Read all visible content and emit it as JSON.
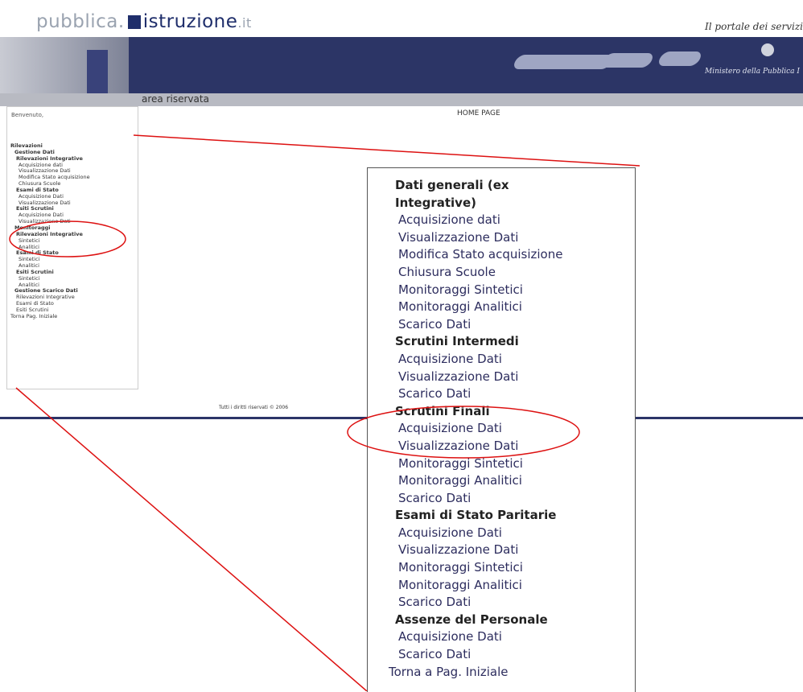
{
  "header": {
    "logo_text_1": "pubblica.",
    "logo_text_2": "istruzione",
    "logo_text_3": ".it",
    "portal_tagline": "Il portale dei servizi",
    "ministry": "Ministero della Pubblica I",
    "area_label": "area riservata"
  },
  "left_panel": {
    "welcome": "Benvenuto,",
    "items": [
      {
        "label": "Rilevazioni",
        "bold": true,
        "indent": 0
      },
      {
        "label": "Gestione Dati",
        "bold": true,
        "indent": 1
      },
      {
        "label": "Rilevazioni Integrative",
        "bold": true,
        "indent": 2
      },
      {
        "label": "Acquisizione dati",
        "bold": false,
        "indent": 3
      },
      {
        "label": "Visualizzazione Dati",
        "bold": false,
        "indent": 3
      },
      {
        "label": "Modifica Stato acquisizione",
        "bold": false,
        "indent": 3
      },
      {
        "label": "Chiusura Scuole",
        "bold": false,
        "indent": 3
      },
      {
        "label": "Esami di Stato",
        "bold": true,
        "indent": 2
      },
      {
        "label": "Acquisizione Dati",
        "bold": false,
        "indent": 3
      },
      {
        "label": "Visualizzazione Dati",
        "bold": false,
        "indent": 3
      },
      {
        "label": "Esiti Scrutini",
        "bold": true,
        "indent": 2
      },
      {
        "label": "Acquisizione Dati",
        "bold": false,
        "indent": 3
      },
      {
        "label": "Visualizzazione Dati",
        "bold": false,
        "indent": 3
      },
      {
        "label": "Monitoraggi",
        "bold": true,
        "indent": 1
      },
      {
        "label": "Rilevazioni Integrative",
        "bold": true,
        "indent": 2
      },
      {
        "label": "Sintetici",
        "bold": false,
        "indent": 3
      },
      {
        "label": "Analitici",
        "bold": false,
        "indent": 3
      },
      {
        "label": "Esami di Stato",
        "bold": true,
        "indent": 2
      },
      {
        "label": "Sintetici",
        "bold": false,
        "indent": 3
      },
      {
        "label": "Analitici",
        "bold": false,
        "indent": 3
      },
      {
        "label": "Esiti Scrutini",
        "bold": true,
        "indent": 2
      },
      {
        "label": "Sintetici",
        "bold": false,
        "indent": 3
      },
      {
        "label": "Analitici",
        "bold": false,
        "indent": 3
      },
      {
        "label": "Gestione Scarico Dati",
        "bold": true,
        "indent": 1
      },
      {
        "label": "Rilevazioni Integrative",
        "bold": false,
        "indent": 2
      },
      {
        "label": "Esami di Stato",
        "bold": false,
        "indent": 2
      },
      {
        "label": "Esiti Scrutini",
        "bold": false,
        "indent": 2
      },
      {
        "label": "Torna Pag. Iniziale",
        "bold": false,
        "indent": 0
      }
    ]
  },
  "main": {
    "title": "HOME PAGE",
    "footer": "Tutti i diritti riservati © 2006"
  },
  "zoomed_menu": {
    "items": [
      {
        "label": "Dati generali (ex",
        "bold": true,
        "indent": 1
      },
      {
        "label": "Integrative)",
        "bold": true,
        "indent": 1
      },
      {
        "label": "Acquisizione dati",
        "bold": false,
        "indent": 2
      },
      {
        "label": "Visualizzazione Dati",
        "bold": false,
        "indent": 2
      },
      {
        "label": "Modifica Stato acquisizione",
        "bold": false,
        "indent": 2
      },
      {
        "label": "Chiusura Scuole",
        "bold": false,
        "indent": 2
      },
      {
        "label": "Monitoraggi Sintetici",
        "bold": false,
        "indent": 2
      },
      {
        "label": "Monitoraggi Analitici",
        "bold": false,
        "indent": 2
      },
      {
        "label": "Scarico Dati",
        "bold": false,
        "indent": 2
      },
      {
        "label": "Scrutini Intermedi",
        "bold": true,
        "indent": 1
      },
      {
        "label": "Acquisizione Dati",
        "bold": false,
        "indent": 2
      },
      {
        "label": "Visualizzazione Dati",
        "bold": false,
        "indent": 2
      },
      {
        "label": "Scarico Dati",
        "bold": false,
        "indent": 2
      },
      {
        "label": "Scrutini Finali",
        "bold": true,
        "indent": 1
      },
      {
        "label": "Acquisizione Dati",
        "bold": false,
        "indent": 2
      },
      {
        "label": "Visualizzazione Dati",
        "bold": false,
        "indent": 2
      },
      {
        "label": "Monitoraggi Sintetici",
        "bold": false,
        "indent": 2
      },
      {
        "label": "Monitoraggi Analitici",
        "bold": false,
        "indent": 2
      },
      {
        "label": "Scarico Dati",
        "bold": false,
        "indent": 2
      },
      {
        "label": "Esami di Stato Paritarie",
        "bold": true,
        "indent": 1
      },
      {
        "label": "Acquisizione Dati",
        "bold": false,
        "indent": 2
      },
      {
        "label": "Visualizzazione Dati",
        "bold": false,
        "indent": 2
      },
      {
        "label": "Monitoraggi Sintetici",
        "bold": false,
        "indent": 2
      },
      {
        "label": "Monitoraggi Analitici",
        "bold": false,
        "indent": 2
      },
      {
        "label": "Scarico Dati",
        "bold": false,
        "indent": 2
      },
      {
        "label": "Assenze del Personale",
        "bold": true,
        "indent": 1
      },
      {
        "label": "Acquisizione Dati",
        "bold": false,
        "indent": 2
      },
      {
        "label": "Scarico Dati",
        "bold": false,
        "indent": 2
      },
      {
        "label": "Torna a Pag. Iniziale",
        "bold": false,
        "indent": 0
      }
    ]
  },
  "annotation_color": "#dd1111"
}
